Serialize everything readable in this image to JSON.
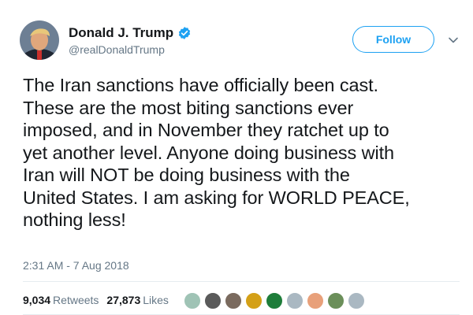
{
  "tweet": {
    "display_name": "Donald J. Trump",
    "handle": "@realDonaldTrump",
    "verified_icon": "verified-badge-icon",
    "follow_label": "Follow",
    "menu_icon": "chevron-down-icon",
    "text": "The Iran sanctions have officially been cast.\nThese are the most biting sanctions ever\nimposed, and in November they ratchet up to\nyet another level. Anyone doing business with\nIran will NOT be doing business with the\nUnited States. I am asking for WORLD PEACE,\nnothing less!",
    "timestamp": "2:31 AM - 7 Aug 2018"
  },
  "stats": {
    "retweets_count": "9,034",
    "retweets_label": "Retweets",
    "likes_count": "27,873",
    "likes_label": "Likes"
  },
  "likers": [
    {
      "name": "liker-avatar-1",
      "color": "#9fc3b5"
    },
    {
      "name": "liker-avatar-2",
      "color": "#5a5a5a"
    },
    {
      "name": "liker-avatar-3",
      "color": "#7a6a5e"
    },
    {
      "name": "liker-avatar-4",
      "color": "#d4a017"
    },
    {
      "name": "liker-avatar-5",
      "color": "#1e7d3a"
    },
    {
      "name": "liker-avatar-6",
      "color": "#aab8c2"
    },
    {
      "name": "liker-avatar-7",
      "color": "#e8a07a"
    },
    {
      "name": "liker-avatar-8",
      "color": "#6b8f5a"
    },
    {
      "name": "liker-avatar-9",
      "color": "#aab8c2"
    }
  ],
  "colors": {
    "accent": "#1da1f2",
    "secondary_text": "#657786",
    "primary_text": "#14171a"
  }
}
